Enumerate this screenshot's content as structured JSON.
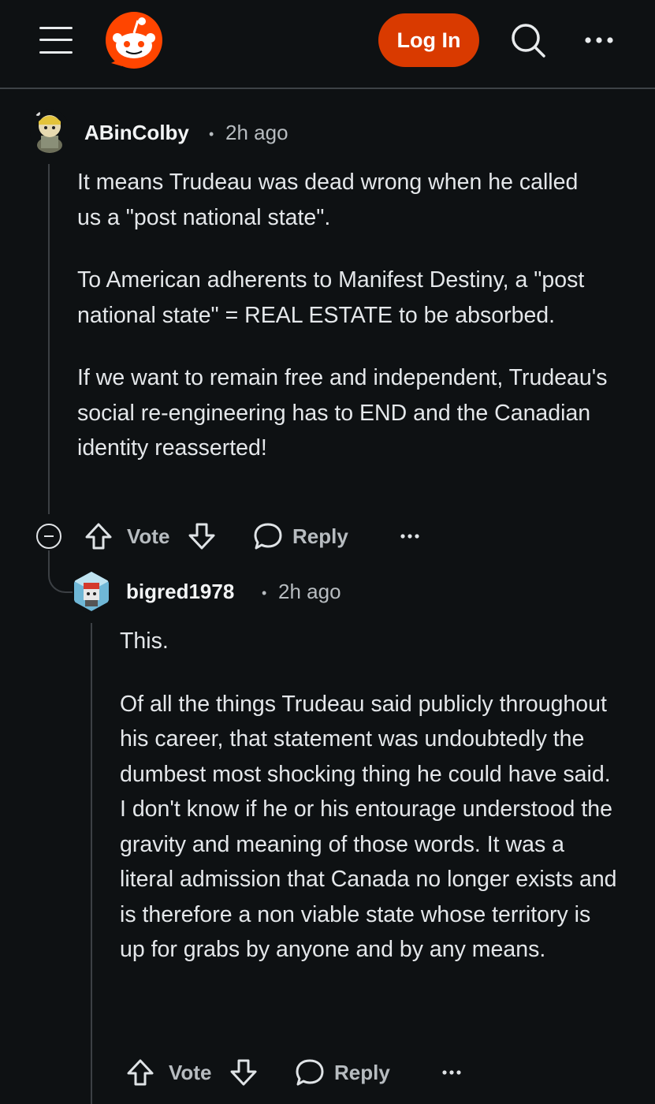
{
  "header": {
    "login_label": "Log In",
    "icons": [
      "menu-icon",
      "reddit-logo",
      "search-icon",
      "more-icon"
    ],
    "accent": "#d93a00"
  },
  "comments": [
    {
      "username": "ABinColby",
      "separator": "•",
      "time": "2h ago",
      "paragraphs": [
        "It means Trudeau was dead wrong when he called us a \"post national state\".",
        "To American adherents to Manifest Destiny, a \"post national state\" = REAL ESTATE to be absorbed.",
        "If we want to remain free and independent, Trudeau's social re-engineering has to END and the Canadian identity reasserted!"
      ],
      "actions": {
        "vote": "Vote",
        "reply": "Reply"
      }
    },
    {
      "username": "bigred1978",
      "separator": "•",
      "time": "2h ago",
      "paragraphs": [
        "This.",
        "Of all the things Trudeau said publicly throughout his career, that statement was undoubtedly the dumbest most shocking thing he could have said. I don't know if he or his entourage understood the gravity and meaning of those words. It was a literal admission that Canada no longer exists and is therefore a non viable state whose territory is up for grabs by anyone and by any means."
      ],
      "actions": {
        "vote": "Vote",
        "reply": "Reply"
      }
    }
  ]
}
